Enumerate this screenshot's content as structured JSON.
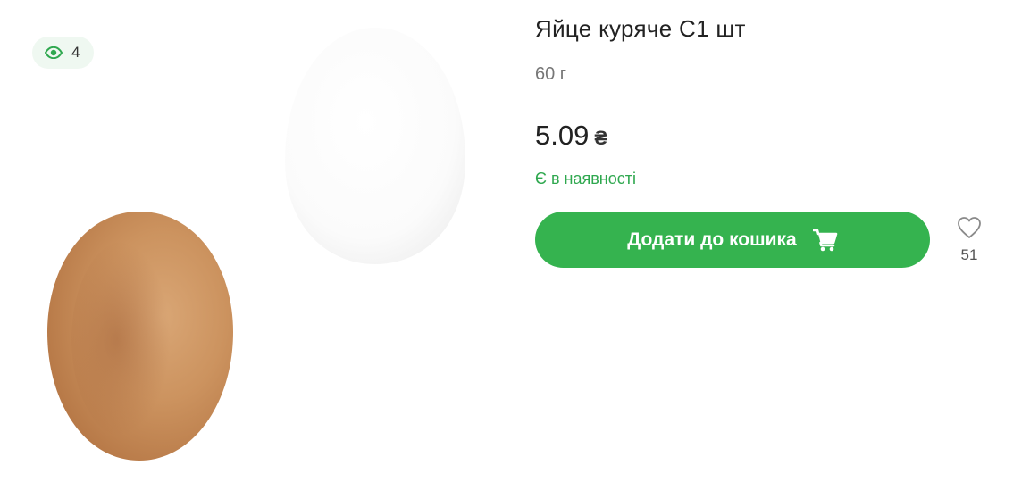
{
  "gallery": {
    "views_count": "4",
    "views_icon": "eye-icon",
    "image_subject": "eggs"
  },
  "product": {
    "title": "Яйце куряче С1 шт",
    "weight": "60 г",
    "price": "5.09",
    "currency": "₴",
    "availability": "Є в наявності"
  },
  "actions": {
    "add_to_cart_label": "Додати до кошика",
    "cart_icon": "cart-icon",
    "favorite_icon": "heart-icon",
    "favorite_count": "51"
  },
  "colors": {
    "accent_green": "#35b34f",
    "availability_green": "#2fa84f",
    "badge_background": "#eff8f1"
  }
}
